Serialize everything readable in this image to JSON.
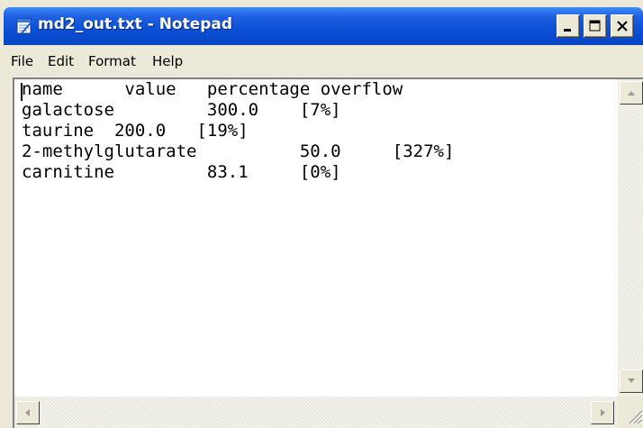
{
  "window": {
    "title": "md2_out.txt - Notepad",
    "title_bar_color": "#0a4fd6",
    "icon": "notepad-icon"
  },
  "title_buttons": {
    "minimize_icon": "minimize-icon",
    "maximize_icon": "maximize-icon",
    "close_icon": "close-icon"
  },
  "menu": {
    "items": [
      "File",
      "Edit",
      "Format",
      "Help"
    ]
  },
  "editor": {
    "lines": [
      "name      value   percentage overflow",
      "galactose         300.0    [7%]",
      "taurine  200.0   [19%]",
      "2-methylglutarate          50.0     [327%]",
      "carnitine         83.1     [0%]"
    ]
  }
}
